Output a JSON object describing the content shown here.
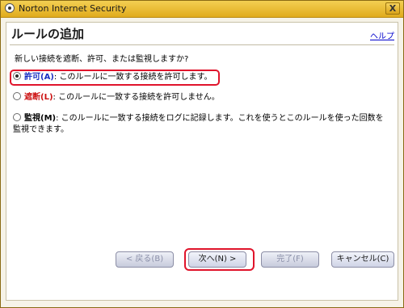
{
  "window": {
    "title": "Norton Internet Security",
    "close_label": "X"
  },
  "dialog": {
    "heading": "ルールの追加",
    "help_link": "ヘルプ",
    "prompt": "新しい接続を遮断、許可、または監視しますか?"
  },
  "options": [
    {
      "label": "許可(A)",
      "colon": ":",
      "description": "このルールに一致する接続を許可します。",
      "checked": true,
      "color": "#1a2fc2"
    },
    {
      "label": "遮断(L)",
      "colon": ":",
      "description": "このルールに一致する接続を許可しません。",
      "checked": false,
      "color": "#cc1111"
    },
    {
      "label": "監視(M)",
      "colon": ":",
      "description": "このルールに一致する接続をログに記録します。これを使うとこのルールを使った回数を監視できます。",
      "checked": false,
      "color": "#000000"
    }
  ],
  "buttons": {
    "back": "< 戻る(B)",
    "next": "次へ(N) >",
    "finish": "完了(F)",
    "cancel": "キャンセル(C)"
  },
  "colors": {
    "titlebar": "#e8b82a",
    "highlight": "#e0142b",
    "link": "#0000cc"
  }
}
